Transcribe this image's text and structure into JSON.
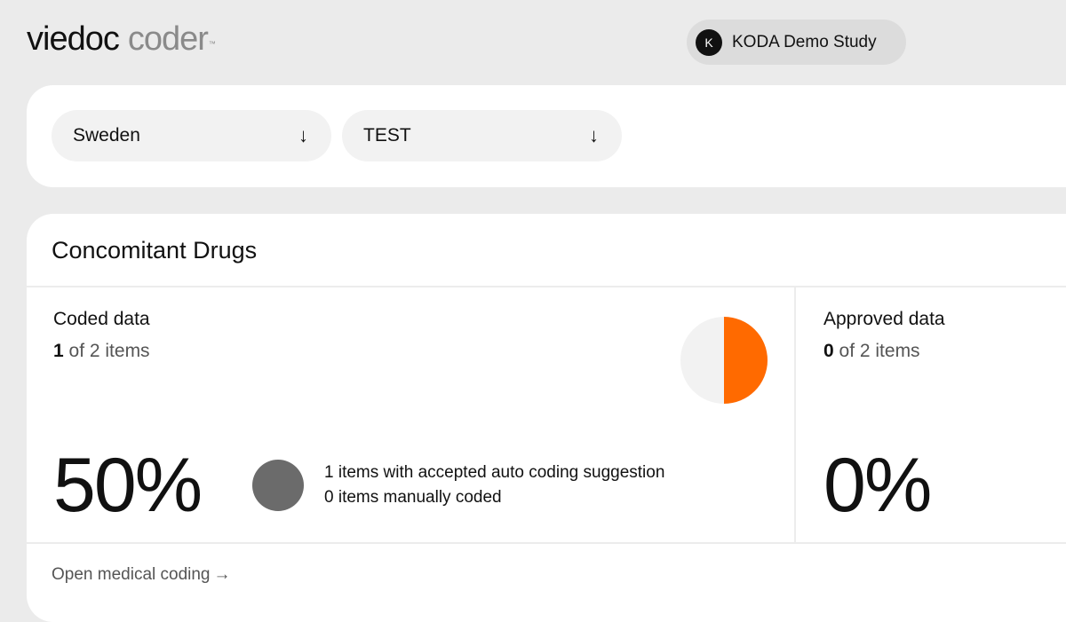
{
  "header": {
    "logo_brand": "viedoc",
    "logo_product": "coder",
    "logo_tm": "™",
    "study": {
      "avatar_letter": "K",
      "name": "KODA Demo Study"
    }
  },
  "filters": {
    "country": {
      "value": "Sweden",
      "arrow": "↓"
    },
    "site": {
      "value": "TEST",
      "arrow": "↓"
    }
  },
  "dictionary_card": {
    "title": "Concomitant Drugs",
    "coded": {
      "label": "Coded data",
      "count_value": "1",
      "count_suffix": " of 2 items",
      "percent": "50%",
      "fraction": 0.5,
      "details": [
        "1 items with accepted auto coding suggestion",
        "0 items manually coded"
      ]
    },
    "approved": {
      "label": "Approved data",
      "count_value": "0",
      "count_suffix": " of 2 items",
      "percent": "0%"
    },
    "open_link": {
      "label": "Open medical coding",
      "arrow": "→"
    }
  },
  "colors": {
    "accent": "#ff6a00",
    "pie_background": "#f2f2f2",
    "dot": "#6b6b6b"
  }
}
